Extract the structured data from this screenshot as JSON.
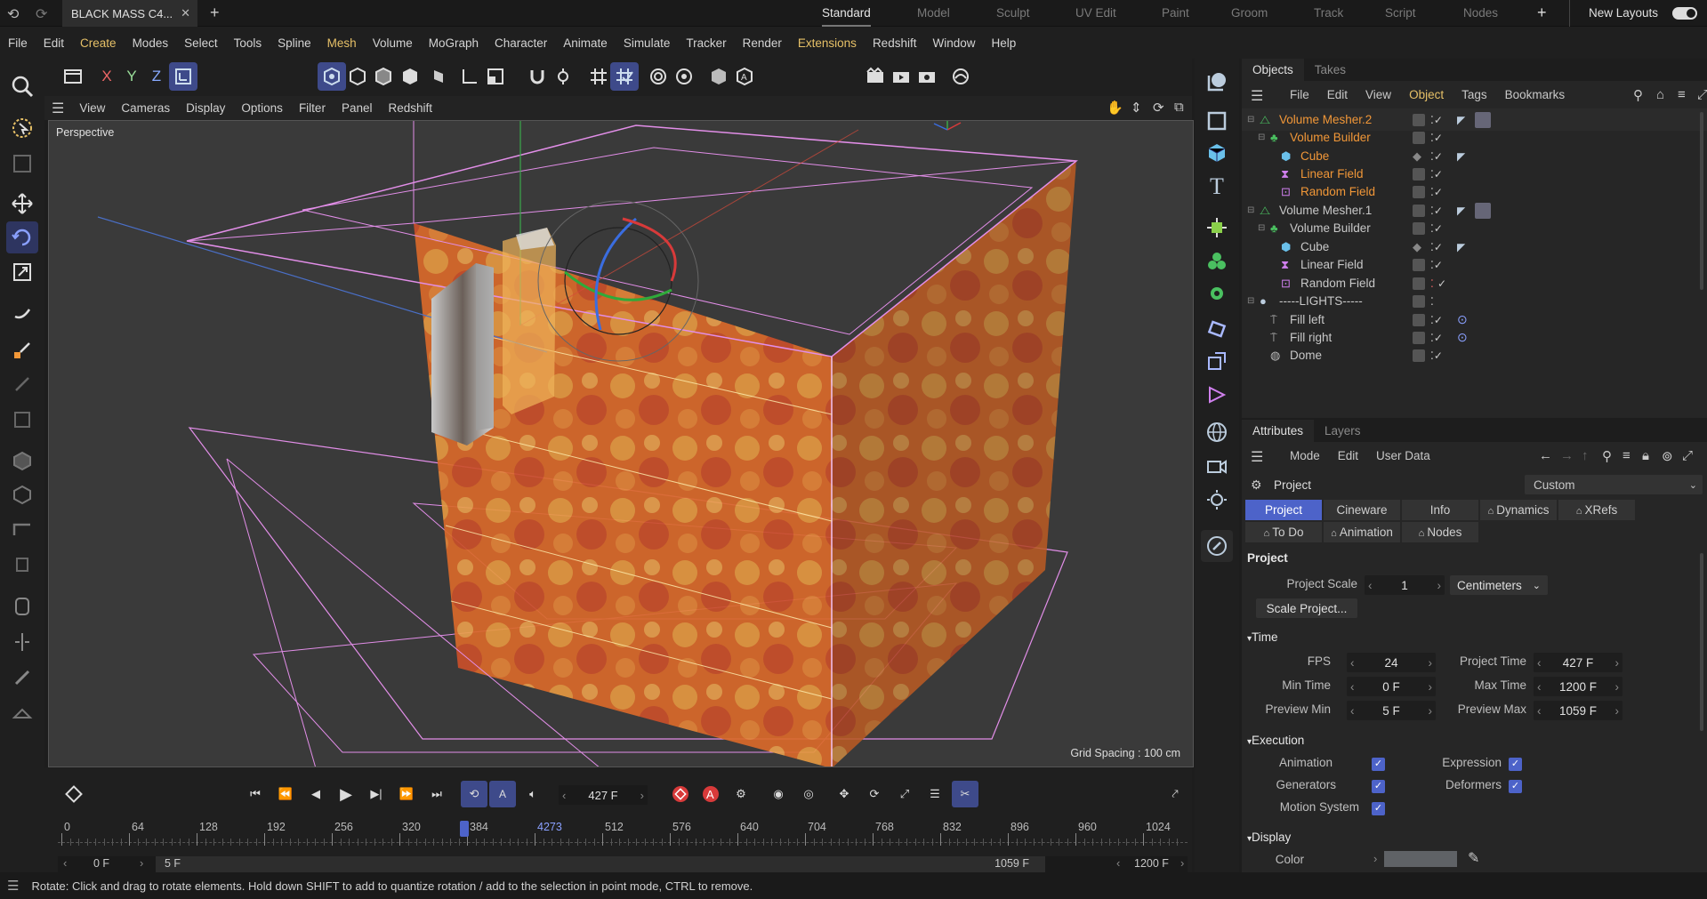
{
  "title_bar": {
    "doc_tab": "BLACK MASS C4...",
    "layouts": [
      "Standard",
      "Model",
      "Sculpt",
      "UV Edit",
      "Paint",
      "Groom",
      "Track",
      "Script",
      "Nodes"
    ],
    "new_layouts": "New Layouts"
  },
  "menubar": [
    "File",
    "Edit",
    "Create",
    "Modes",
    "Select",
    "Tools",
    "Spline",
    "Mesh",
    "Volume",
    "MoGraph",
    "Character",
    "Animate",
    "Simulate",
    "Tracker",
    "Render",
    "Extensions",
    "Redshift",
    "Window",
    "Help"
  ],
  "top_toolbar": {
    "axis_x": "X",
    "axis_y": "Y",
    "axis_z": "Z"
  },
  "viewport_menu": [
    "View",
    "Cameras",
    "Display",
    "Options",
    "Filter",
    "Panel",
    "Redshift"
  ],
  "viewport": {
    "label": "Perspective",
    "grid_spacing": "Grid Spacing : 100 cm"
  },
  "objects_panel": {
    "tabs": [
      "Objects",
      "Takes"
    ],
    "menu": [
      "File",
      "Edit",
      "View",
      "Object",
      "Tags",
      "Bookmarks"
    ],
    "items": [
      {
        "name": "Volume Mesher.2",
        "color": "orange"
      },
      {
        "name": "Volume Builder",
        "color": "orange"
      },
      {
        "name": "Cube",
        "color": "orange"
      },
      {
        "name": "Linear Field",
        "color": "orange"
      },
      {
        "name": "Random Field",
        "color": "orange"
      },
      {
        "name": "Volume Mesher.1",
        "color": "white"
      },
      {
        "name": "Volume Builder",
        "color": "white"
      },
      {
        "name": "Cube",
        "color": "white"
      },
      {
        "name": "Linear Field",
        "color": "white"
      },
      {
        "name": "Random Field",
        "color": "white"
      },
      {
        "name": "-----LIGHTS-----",
        "color": "white"
      },
      {
        "name": "Fill left",
        "color": "white"
      },
      {
        "name": "Fill right",
        "color": "white"
      },
      {
        "name": "Dome",
        "color": "white"
      }
    ]
  },
  "attributes_panel": {
    "tabs": [
      "Attributes",
      "Layers"
    ],
    "menu": [
      "Mode",
      "Edit",
      "User Data"
    ],
    "object_label": "Project",
    "custom_dropdown": "Custom",
    "sub_tabs_row1": [
      "Project",
      "Cineware",
      "Info",
      "Dynamics",
      "XRefs"
    ],
    "sub_tabs_row2": [
      "To Do",
      "Animation",
      "Nodes"
    ],
    "section_project": "Project",
    "project_scale_label": "Project Scale",
    "project_scale_value": "1",
    "project_scale_unit": "Centimeters",
    "scale_project_button": "Scale Project...",
    "section_time": "Time",
    "fps_label": "FPS",
    "fps_value": "24",
    "project_time_label": "Project Time",
    "project_time_value": "427 F",
    "min_time_label": "Min Time",
    "min_time_value": "0 F",
    "max_time_label": "Max Time",
    "max_time_value": "1200 F",
    "preview_min_label": "Preview Min",
    "preview_min_value": "5 F",
    "preview_max_label": "Preview Max",
    "preview_max_value": "1059 F",
    "section_execution": "Execution",
    "exec_animation": "Animation",
    "exec_expression": "Expression",
    "exec_generators": "Generators",
    "exec_deformers": "Deformers",
    "exec_motion_system": "Motion System",
    "section_display": "Display",
    "color_label": "Color"
  },
  "timeline": {
    "current_frame": "427 F",
    "ruler_ticks": [
      "0",
      "64",
      "128",
      "192",
      "256",
      "320",
      "384",
      "4273",
      "512",
      "576",
      "640",
      "704",
      "768",
      "832",
      "896",
      "960",
      "1024"
    ],
    "range_start": "0 F",
    "preview_start": "5 F",
    "preview_end": "1059 F",
    "range_end": "1200 F",
    "playhead_fraction": 0.356
  },
  "status_text": "Rotate: Click and drag to rotate elements. Hold down SHIFT to add to quantize rotation / add to the selection in point mode, CTRL to remove."
}
